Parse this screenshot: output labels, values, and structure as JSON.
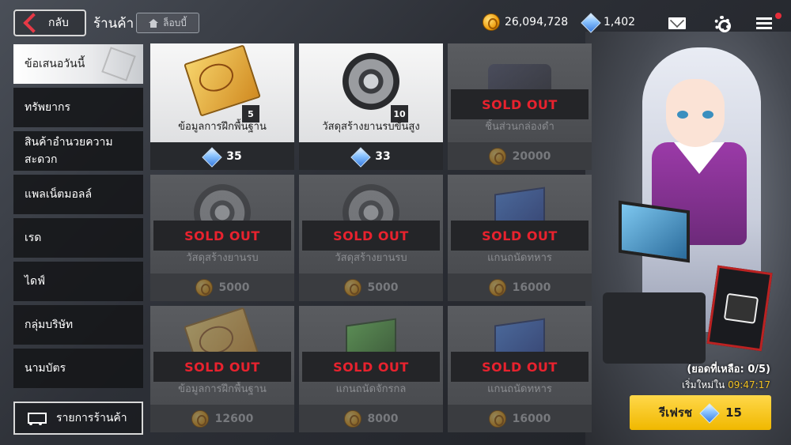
{
  "header": {
    "back_label": "กลับ",
    "title": "ร้านค้า",
    "lobby_label": "ล็อบบี้",
    "coins": "26,094,728",
    "gems": "1,402"
  },
  "sidebar": {
    "items": [
      {
        "label": "ข้อเสนอวันนี้",
        "active": true
      },
      {
        "label": "ทรัพยากร"
      },
      {
        "label": "สินค้าอำนวยความสะดวก"
      },
      {
        "label": "แพลเน็ตมอลล์"
      },
      {
        "label": "เรด"
      },
      {
        "label": "ไดฟ์"
      },
      {
        "label": "กลุ่มบริษัท"
      },
      {
        "label": "นามบัตร"
      }
    ],
    "cart_label": "รายการร้านค้า"
  },
  "shop": {
    "sold_out_label": "SOLD OUT",
    "items": [
      {
        "name": "ข้อมูลการฝึกพื้นฐาน",
        "qty": "5",
        "price": "35",
        "currency": "gem",
        "sold_out": false,
        "art": "manual"
      },
      {
        "name": "วัสดุสร้างยานรบขั้นสูง",
        "qty": "10",
        "price": "33",
        "currency": "gem",
        "sold_out": false,
        "art": "gear"
      },
      {
        "name": "ชิ้นส่วนกล่องดำ",
        "qty": "",
        "price": "20000",
        "currency": "coin",
        "sold_out": true,
        "art": "camera"
      },
      {
        "name": "วัสดุสร้างยานรบ",
        "qty": "",
        "price": "5000",
        "currency": "coin",
        "sold_out": true,
        "art": "gear"
      },
      {
        "name": "วัสดุสร้างยานรบ",
        "qty": "",
        "price": "5000",
        "currency": "coin",
        "sold_out": true,
        "art": "gear"
      },
      {
        "name": "แกนถนัดทหาร",
        "qty": "",
        "price": "16000",
        "currency": "coin",
        "sold_out": true,
        "art": "box-blue"
      },
      {
        "name": "ข้อมูลการฝึกพื้นฐาน",
        "qty": "",
        "price": "12600",
        "currency": "coin",
        "sold_out": true,
        "art": "manual"
      },
      {
        "name": "แกนถนัดจักรกล",
        "qty": "",
        "price": "8000",
        "currency": "coin",
        "sold_out": true,
        "art": "box-green"
      },
      {
        "name": "แกนถนัดทหาร",
        "qty": "",
        "price": "16000",
        "currency": "coin",
        "sold_out": true,
        "art": "box-blue"
      }
    ]
  },
  "panel": {
    "remaining": "(ยอดที่เหลือ: 0/5)",
    "reset_label": "เริ่มใหม่ใน",
    "reset_time": "09:47:17",
    "refresh_label": "รีเฟรช",
    "refresh_cost": "15"
  },
  "colors": {
    "sold_out": "#e8222e",
    "refresh": "#f0b800",
    "back_accent": "#e63946"
  }
}
